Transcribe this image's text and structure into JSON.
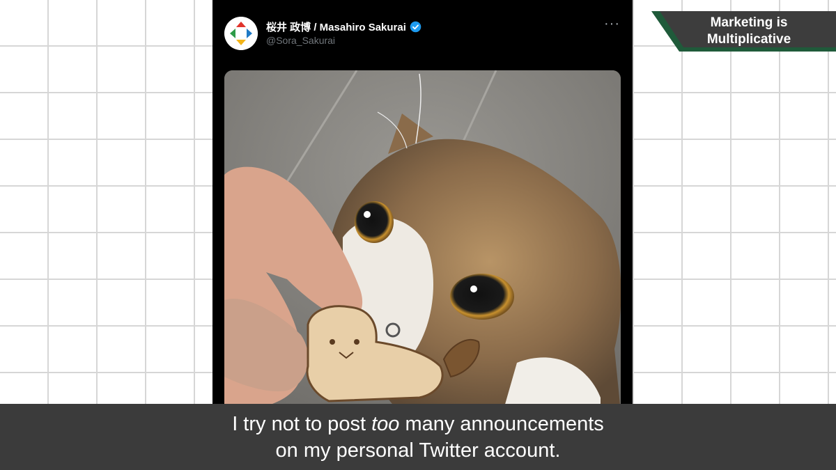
{
  "tweet": {
    "display_name": "桜井 政博 / Masahiro Sakurai",
    "handle": "@Sora_Sakurai",
    "more_label": "···",
    "verified_icon": "verified-badge-icon",
    "avatar_icon": "game-controller-logo-icon"
  },
  "caption": {
    "line1_before": "I try not to post ",
    "line1_emphasis": "too",
    "line1_after": " many announcements",
    "line2": "on my personal Twitter account."
  },
  "badge": {
    "line1": "Marketing is",
    "line2": "Multiplicative"
  },
  "colors": {
    "tweet_background": "#000000",
    "handle_gray": "#71767b",
    "verified_blue": "#1d9bf0",
    "caption_bar": "#3b3b3b",
    "badge_dark": "#3d3d3d",
    "badge_green": "#1f5a3a",
    "grid_line": "#d6d6d6"
  }
}
